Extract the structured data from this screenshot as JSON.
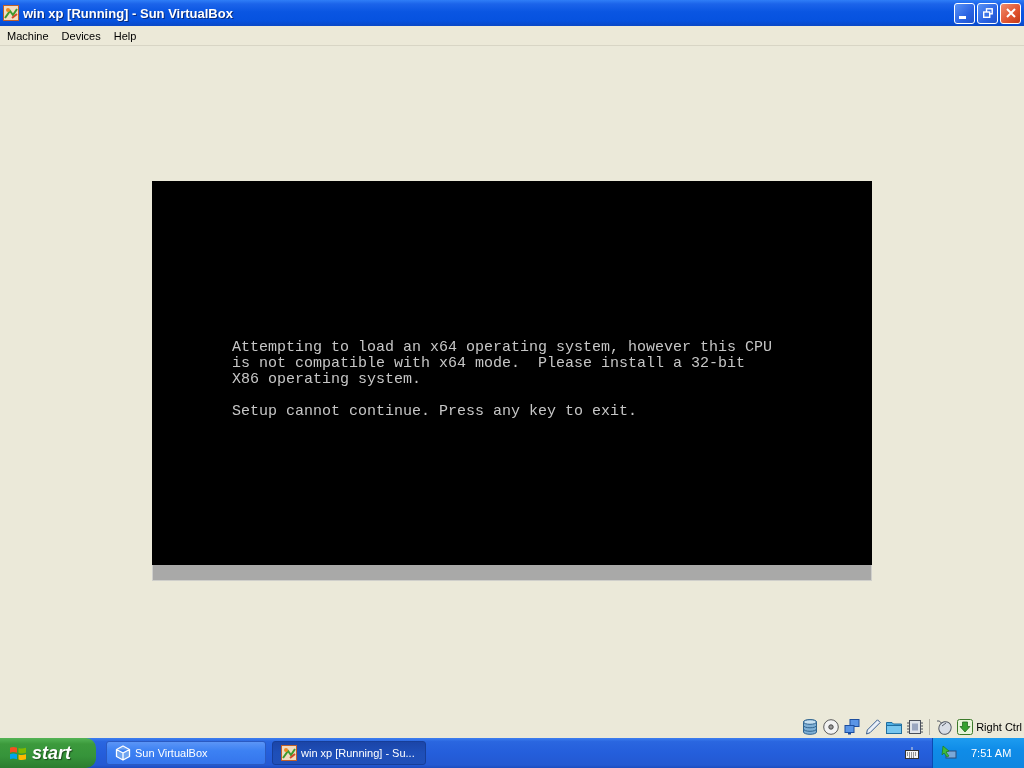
{
  "window": {
    "title": "win xp [Running] - Sun VirtualBox"
  },
  "menu_bar": {
    "items": [
      "Machine",
      "Devices",
      "Help"
    ]
  },
  "vm_display": {
    "paragraphs": [
      {
        "lines": [
          "Attempting to load an x64 operating system, however this CPU",
          "is not compatible with x64 mode.  Please install a 32-bit",
          "X86 operating system."
        ]
      },
      {
        "lines": [
          "Setup cannot continue. Press any key to exit."
        ]
      }
    ]
  },
  "status_bar": {
    "host_key": "Right Ctrl"
  },
  "taskbar": {
    "start_label": "start",
    "tasks": [
      {
        "kind": "manager",
        "label": "Sun VirtualBox",
        "selected": false
      },
      {
        "kind": "vm",
        "label": "win xp [Running] - Su...",
        "selected": true
      }
    ],
    "clock": "7:51 AM"
  }
}
